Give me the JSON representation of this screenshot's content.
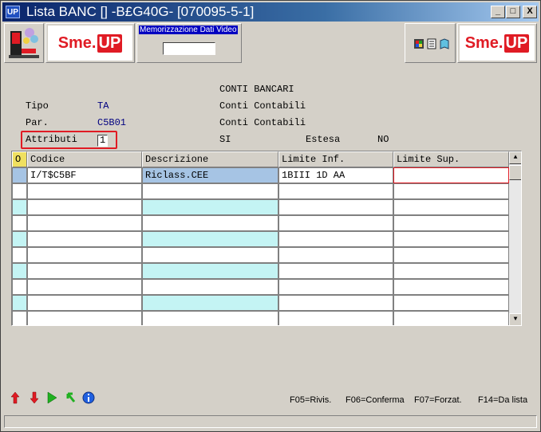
{
  "window": {
    "title": "Lista BANC [] -B£G40G- [070095-5-1]",
    "app_icon": "UP",
    "min_glyph": "_",
    "max_glyph": "□",
    "close_glyph": "X"
  },
  "toolbar": {
    "logo_left": {
      "sme": "Sme.",
      "up": "UP"
    },
    "logo_right": {
      "sme": "Sme.",
      "up": "UP"
    },
    "memo_label": "Memorizzazione Dati Video",
    "memo_value": ""
  },
  "header": {
    "heading": "CONTI BANCARI",
    "tipo_label": "Tipo",
    "tipo_value": "TA",
    "tipo_desc": "Conti Contabili",
    "par_label": "Par.",
    "par_value": "C5B01",
    "par_desc": "Conti Contabili",
    "attributi_label": "Attributi",
    "attributi_value": "1",
    "si_label": "SI",
    "estesa_label": "Estesa",
    "estesa_value": "NO"
  },
  "grid": {
    "columns": [
      "O",
      "Codice",
      "Descrizione",
      "Limite Inf.",
      "Limite Sup."
    ],
    "rows": [
      {
        "codice": "I/T$C5BF",
        "descrizione": "Riclass.CEE",
        "limite_inf": "1BIII  1D AA",
        "limite_sup": ""
      },
      {
        "codice": "",
        "descrizione": "",
        "limite_inf": "",
        "limite_sup": ""
      },
      {
        "codice": "",
        "descrizione": "",
        "limite_inf": "",
        "limite_sup": ""
      },
      {
        "codice": "",
        "descrizione": "",
        "limite_inf": "",
        "limite_sup": ""
      },
      {
        "codice": "",
        "descrizione": "",
        "limite_inf": "",
        "limite_sup": ""
      },
      {
        "codice": "",
        "descrizione": "",
        "limite_inf": "",
        "limite_sup": ""
      },
      {
        "codice": "",
        "descrizione": "",
        "limite_inf": "",
        "limite_sup": ""
      },
      {
        "codice": "",
        "descrizione": "",
        "limite_inf": "",
        "limite_sup": ""
      },
      {
        "codice": "",
        "descrizione": "",
        "limite_inf": "",
        "limite_sup": ""
      },
      {
        "codice": "",
        "descrizione": "",
        "limite_inf": "",
        "limite_sup": ""
      }
    ],
    "scroll_up": "▲",
    "scroll_down": "▼"
  },
  "bottom_icons": [
    "arrow-up-red-icon",
    "arrow-down-red-icon",
    "play-green-icon",
    "refresh-green-icon",
    "info-icon"
  ],
  "function_keys": {
    "f05": "F05=Rivis.",
    "f06": "F06=Conferma",
    "f07": "F07=Forzat.",
    "f14": "F14=Da lista"
  },
  "colors": {
    "title_bar": "#0a246a",
    "logo_red": "#e01b24",
    "row_selected": "#a6c4e4",
    "row_alt": "#c4f4f4",
    "text_blue": "#000080"
  }
}
